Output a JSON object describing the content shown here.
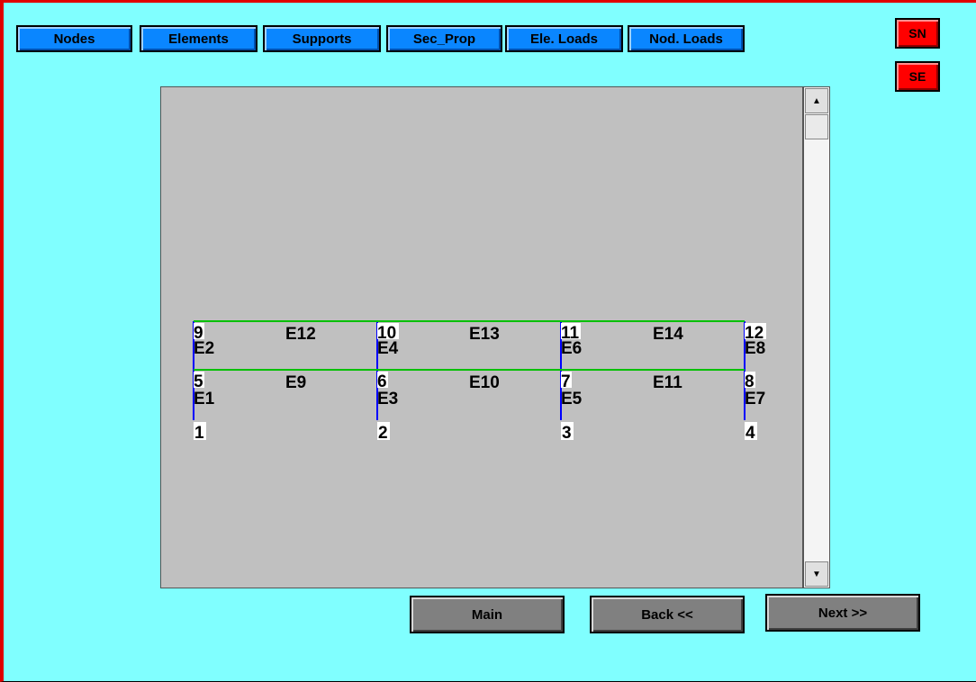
{
  "toolbar": {
    "buttons": [
      "Nodes",
      "Elements",
      "Supports",
      "Sec_Prop",
      "Ele. Loads",
      "Nod. Loads"
    ]
  },
  "side_buttons": {
    "sn": "SN",
    "se": "SE"
  },
  "nav": {
    "main": "Main",
    "back": "Back <<",
    "next": "Next >>"
  },
  "structure": {
    "nodes": [
      "1",
      "2",
      "3",
      "4",
      "5",
      "6",
      "7",
      "8",
      "9",
      "10",
      "11",
      "12"
    ],
    "column_elements": [
      "E1",
      "E2",
      "E3",
      "E4",
      "E5",
      "E6",
      "E7",
      "E8"
    ],
    "beam_elements": [
      "E9",
      "E10",
      "E11",
      "E12",
      "E13",
      "E14"
    ]
  },
  "colors": {
    "background": "#80ffff",
    "canvas": "#c0c0c0",
    "column_line": "#0000ff",
    "beam_line": "#00c000",
    "blue_button": "#0a86ff",
    "red_button": "#ff0000",
    "gray_button": "#808080"
  }
}
